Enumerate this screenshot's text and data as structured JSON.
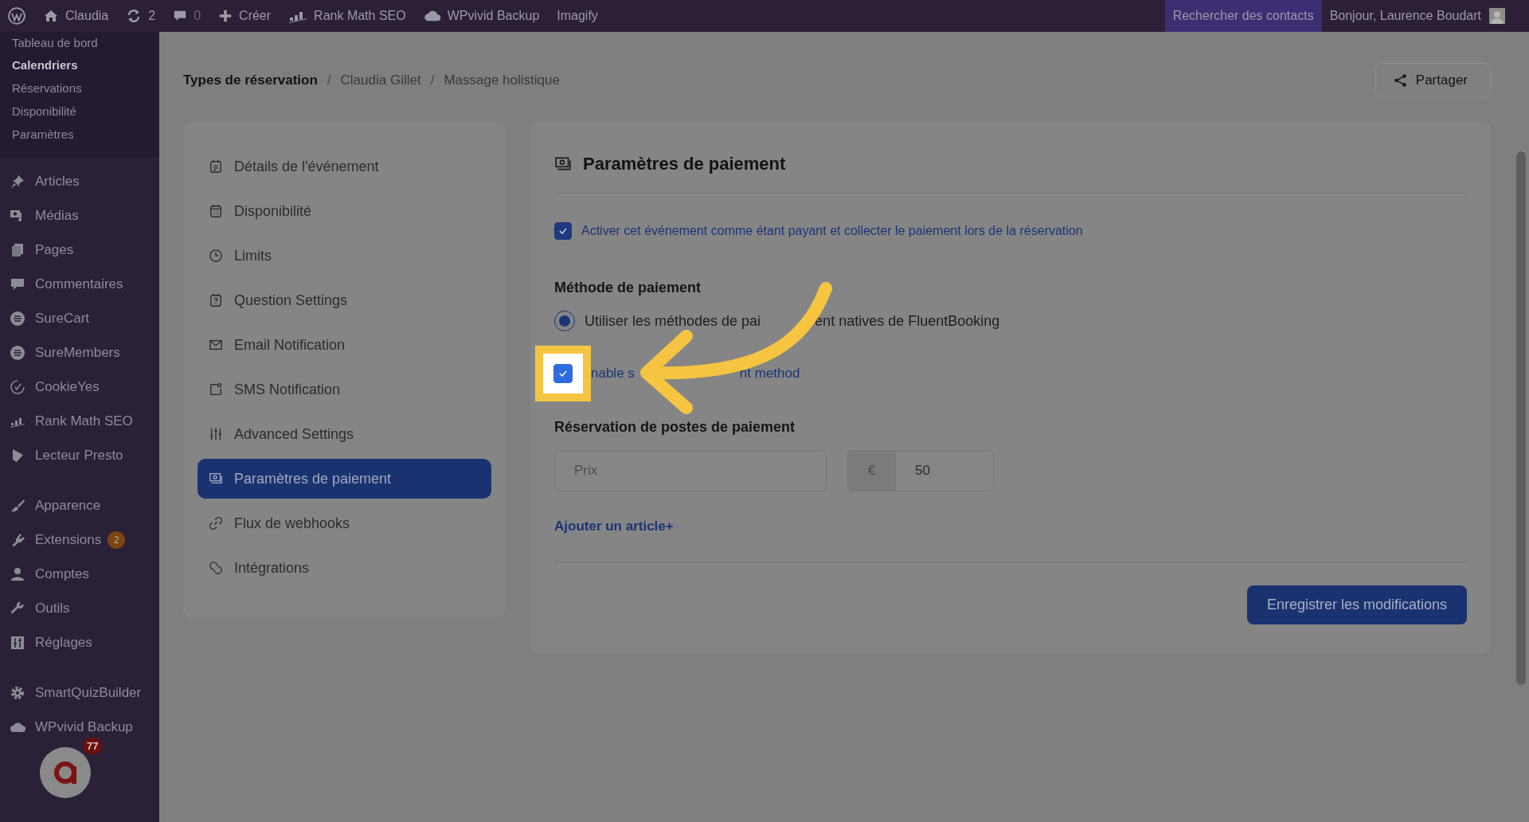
{
  "top_bar": {
    "items": [
      {
        "label": "Claudia"
      },
      {
        "label": "2"
      },
      {
        "label": "0"
      },
      {
        "label": "Créer"
      },
      {
        "label": "Rank Math SEO"
      },
      {
        "label": "WPvivid Backup"
      },
      {
        "label": "Imagify"
      }
    ],
    "search_contacts": "Rechercher des contacts",
    "greeting": "Bonjour, Laurence Boudart"
  },
  "sidebar": {
    "submenu": [
      {
        "label": "Tableau de bord",
        "selected": false
      },
      {
        "label": "Calendriers",
        "selected": true
      },
      {
        "label": "Réservations",
        "selected": false
      },
      {
        "label": "Disponibilité",
        "selected": false
      },
      {
        "label": "Paramètres",
        "selected": false
      }
    ],
    "groups": [
      [
        {
          "label": "Articles"
        },
        {
          "label": "Médias"
        },
        {
          "label": "Pages"
        },
        {
          "label": "Commentaires"
        },
        {
          "label": "SureCart"
        },
        {
          "label": "SureMembers"
        },
        {
          "label": "CookieYes"
        },
        {
          "label": "Rank Math SEO"
        },
        {
          "label": "Lecteur Presto"
        }
      ],
      [
        {
          "label": "Apparence"
        },
        {
          "label": "Extensions",
          "badge": "2"
        },
        {
          "label": "Comptes"
        },
        {
          "label": "Outils"
        },
        {
          "label": "Réglages"
        }
      ],
      [
        {
          "label": "SmartQuizBuilder"
        },
        {
          "label": "WPvivid Backup"
        }
      ]
    ],
    "widget_badge": "77"
  },
  "breadcrumb": {
    "separator": "/",
    "items": [
      "Types de réservation",
      "Claudia Gillet",
      "Massage holistique"
    ]
  },
  "share_button": "Partager",
  "nav": [
    {
      "label": "Détails de l'événement",
      "selected": false
    },
    {
      "label": "Disponibilité",
      "selected": false
    },
    {
      "label": "Limits",
      "selected": false
    },
    {
      "label": "Question Settings",
      "selected": false
    },
    {
      "label": "Email Notification",
      "selected": false
    },
    {
      "label": "SMS Notification",
      "selected": false
    },
    {
      "label": "Advanced Settings",
      "selected": false
    },
    {
      "label": "Paramètres de paiement",
      "selected": true
    },
    {
      "label": "Flux de webhooks",
      "selected": false
    },
    {
      "label": "Intégrations",
      "selected": false
    }
  ],
  "panel": {
    "title": "Paramètres de paiement",
    "paid_event": {
      "label": "Activer cet événement comme étant payant et collecter le paiement lors de la réservation",
      "checked": true
    },
    "method_heading": "Méthode de paiement",
    "method_option": {
      "label_parts": [
        "Utiliser les méthodes de pai",
        "ent natives de FluentBooking"
      ],
      "selected": true
    },
    "enable_option": {
      "label_parts": [
        "nable s",
        "nt method"
      ],
      "checked": true
    },
    "items_heading": "Réservation de postes de paiement",
    "item": {
      "name_placeholder": "Prix",
      "currency": "€",
      "price": "50"
    },
    "add_item": "Ajouter un article+",
    "save_button": "Enregistrer les modifications"
  }
}
